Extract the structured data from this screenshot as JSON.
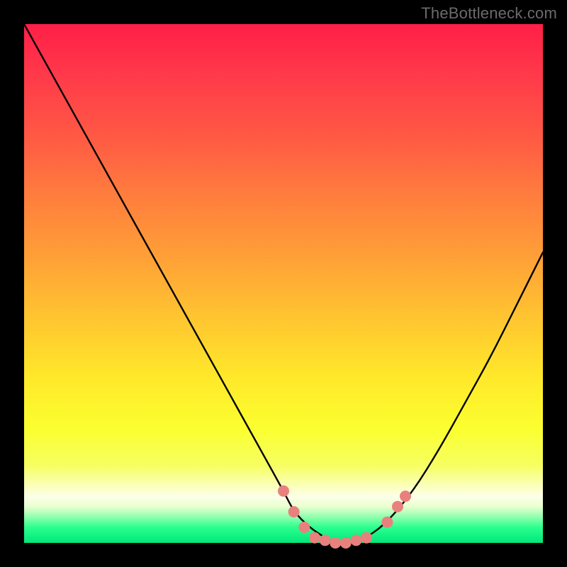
{
  "watermark": "TheBottleneck.com",
  "chart_data": {
    "type": "line",
    "title": "",
    "xlabel": "",
    "ylabel": "",
    "xlim": [
      0,
      100
    ],
    "ylim": [
      0,
      100
    ],
    "grid": false,
    "background_gradient": {
      "direction": "vertical",
      "stops": [
        {
          "pos": 0.0,
          "color": "#ff1f47"
        },
        {
          "pos": 0.32,
          "color": "#ff7a3e"
        },
        {
          "pos": 0.68,
          "color": "#ffe82a"
        },
        {
          "pos": 0.91,
          "color": "#fdffe8"
        },
        {
          "pos": 1.0,
          "color": "#00e77a"
        }
      ]
    },
    "series": [
      {
        "name": "bottleneck-curve",
        "color": "#000000",
        "x": [
          0,
          5,
          10,
          15,
          20,
          25,
          30,
          35,
          40,
          45,
          50,
          52,
          55,
          58,
          60,
          63,
          66,
          70,
          75,
          80,
          85,
          90,
          95,
          100
        ],
        "y": [
          100,
          91,
          82,
          73,
          64,
          55,
          46,
          37,
          28,
          19,
          10,
          6,
          3,
          1,
          0,
          0,
          1,
          4,
          10,
          18,
          27,
          36,
          46,
          56
        ]
      }
    ],
    "markers": {
      "name": "highlight-dots",
      "color": "#e8817d",
      "points": [
        {
          "x": 50.0,
          "y": 10.0
        },
        {
          "x": 52.0,
          "y": 6.0
        },
        {
          "x": 54.0,
          "y": 3.0
        },
        {
          "x": 56.0,
          "y": 1.0
        },
        {
          "x": 58.0,
          "y": 0.5
        },
        {
          "x": 60.0,
          "y": 0.0
        },
        {
          "x": 62.0,
          "y": 0.0
        },
        {
          "x": 64.0,
          "y": 0.5
        },
        {
          "x": 66.0,
          "y": 1.0
        },
        {
          "x": 70.0,
          "y": 4.0
        },
        {
          "x": 72.0,
          "y": 7.0
        },
        {
          "x": 73.5,
          "y": 9.0
        }
      ]
    }
  }
}
